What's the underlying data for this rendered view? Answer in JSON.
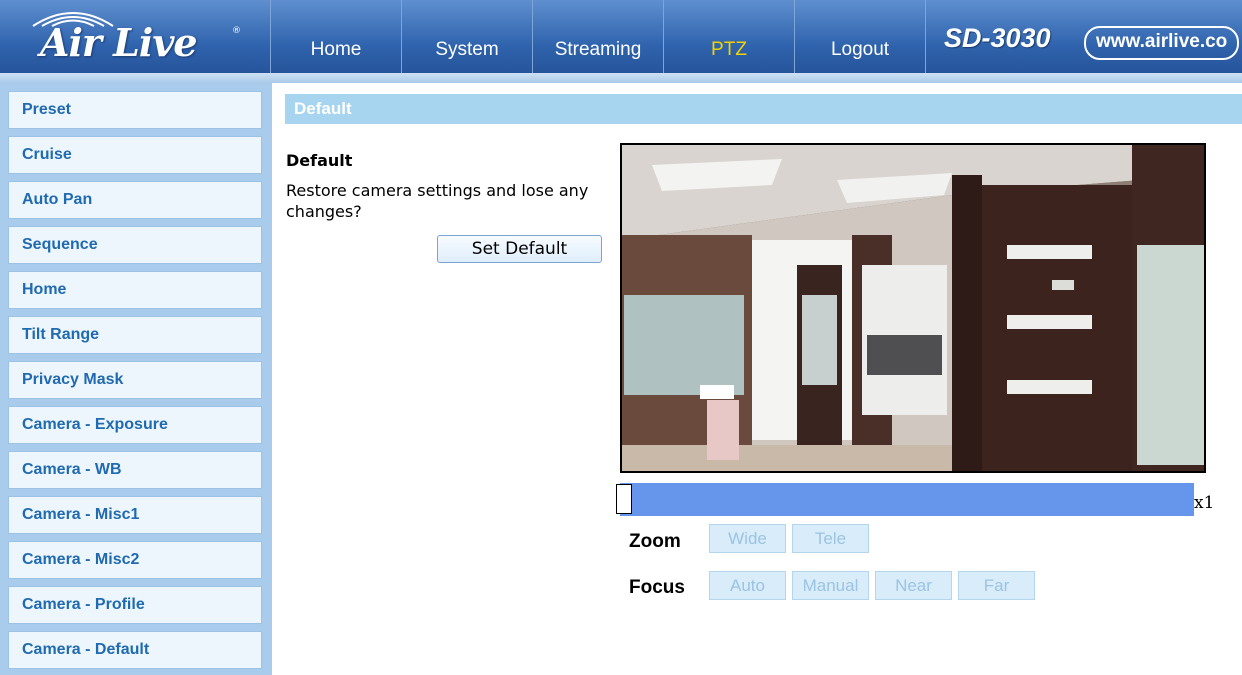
{
  "header": {
    "logo_text": "Air Live",
    "logo_reg": "®",
    "nav": [
      "Home",
      "System",
      "Streaming",
      "PTZ",
      "Logout"
    ],
    "active_nav": "PTZ",
    "model": "SD-3030",
    "url": "www.airlive.co"
  },
  "sidebar": {
    "items": [
      {
        "label": "Preset"
      },
      {
        "label": "Cruise"
      },
      {
        "label": "Auto Pan"
      },
      {
        "label": "Sequence"
      },
      {
        "label": "Home"
      },
      {
        "label": "Tilt Range"
      },
      {
        "label": "Privacy Mask"
      },
      {
        "label": "Camera - Exposure"
      },
      {
        "label": "Camera - WB"
      },
      {
        "label": "Camera - Misc1"
      },
      {
        "label": "Camera - Misc2"
      },
      {
        "label": "Camera - Profile"
      },
      {
        "label": "Camera - Default"
      }
    ]
  },
  "main": {
    "section_title": "Default",
    "default_title": "Default",
    "default_desc": "Restore camera settings and lose any changes?",
    "set_default_label": "Set Default"
  },
  "controls": {
    "zoom_level": "x1",
    "zoom_label": "Zoom",
    "zoom_buttons": [
      "Wide",
      "Tele"
    ],
    "focus_label": "Focus",
    "focus_buttons": [
      "Auto",
      "Manual",
      "Near",
      "Far"
    ]
  },
  "colors": {
    "header_blue": "#2f63ad",
    "nav_active": "#f2d200",
    "sidebar_bg": "#a9cbec",
    "sidebar_text": "#1f6ab0",
    "section_bar": "#a7d4ef",
    "zoom_slider": "#6596ec"
  }
}
